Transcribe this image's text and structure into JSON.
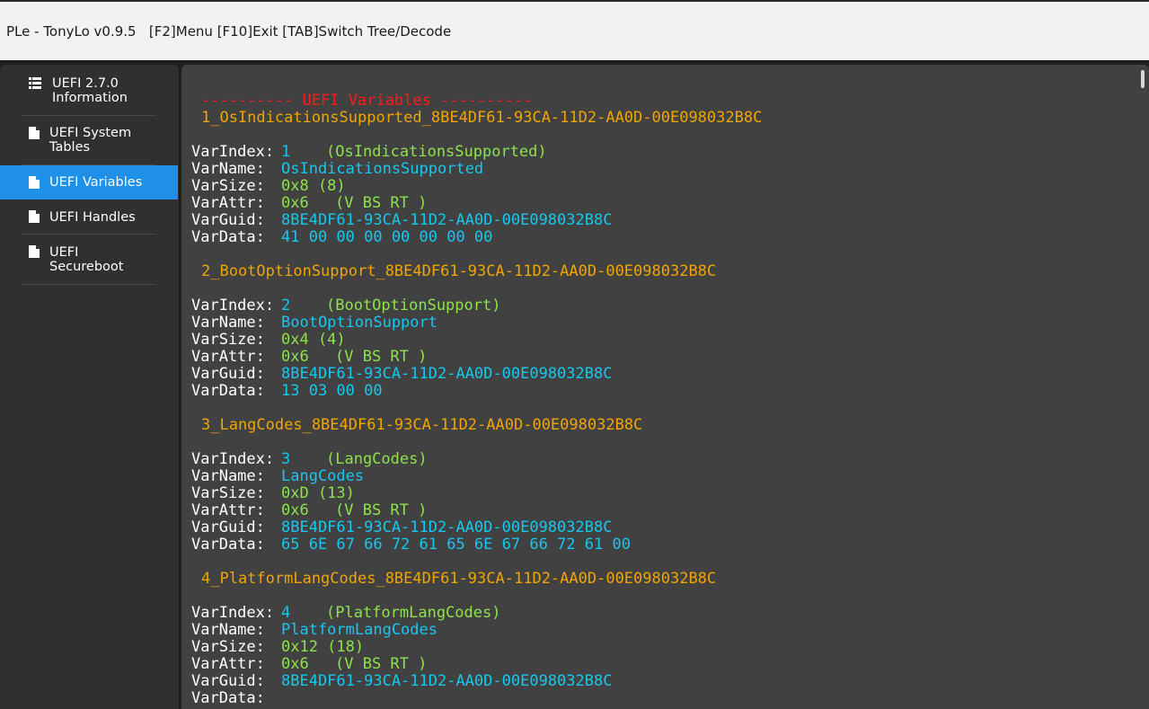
{
  "titlebar": {
    "text": "PLe - TonyLo v0.9.5   [F2]Menu [F10]Exit [TAB]Switch Tree/Decode"
  },
  "sidebar": {
    "items": [
      {
        "label": "UEFI 2.7.0 Information",
        "icon": "list-icon",
        "active": false
      },
      {
        "label": "UEFI System Tables",
        "icon": "file-icon",
        "active": false
      },
      {
        "label": "UEFI Variables",
        "icon": "file-icon",
        "active": true
      },
      {
        "label": "UEFI Handles",
        "icon": "file-icon",
        "active": false
      },
      {
        "label": "UEFI Secureboot",
        "icon": "file-icon",
        "active": false
      }
    ]
  },
  "content": {
    "header": "---------- UEFI Variables ----------",
    "field_labels": {
      "index": "VarIndex:",
      "name": "VarName:",
      "size": "VarSize:",
      "attr": "VarAttr:",
      "guid": "VarGuid:",
      "data": "VarData:"
    },
    "variables": [
      {
        "title": "1_OsIndicationsSupported_8BE4DF61-93CA-11D2-AA0D-00E098032B8C",
        "index": "1",
        "index_name": "(OsIndicationsSupported)",
        "name": "OsIndicationsSupported",
        "size": "0x8 (8)",
        "attr": "0x6",
        "attr_flags": "(V BS RT )",
        "guid": "8BE4DF61-93CA-11D2-AA0D-00E098032B8C",
        "data": "41 00 00 00 00 00 00 00"
      },
      {
        "title": "2_BootOptionSupport_8BE4DF61-93CA-11D2-AA0D-00E098032B8C",
        "index": "2",
        "index_name": "(BootOptionSupport)",
        "name": "BootOptionSupport",
        "size": "0x4 (4)",
        "attr": "0x6",
        "attr_flags": "(V BS RT )",
        "guid": "8BE4DF61-93CA-11D2-AA0D-00E098032B8C",
        "data": "13 03 00 00"
      },
      {
        "title": "3_LangCodes_8BE4DF61-93CA-11D2-AA0D-00E098032B8C",
        "index": "3",
        "index_name": "(LangCodes)",
        "name": "LangCodes",
        "size": "0xD (13)",
        "attr": "0x6",
        "attr_flags": "(V BS RT )",
        "guid": "8BE4DF61-93CA-11D2-AA0D-00E098032B8C",
        "data": "65 6E 67 66 72 61 65 6E 67 66 72 61 00"
      },
      {
        "title": "4_PlatformLangCodes_8BE4DF61-93CA-11D2-AA0D-00E098032B8C",
        "index": "4",
        "index_name": "(PlatformLangCodes)",
        "name": "PlatformLangCodes",
        "size": "0x12 (18)",
        "attr": "0x6",
        "attr_flags": "(V BS RT )",
        "guid": "8BE4DF61-93CA-11D2-AA0D-00E098032B8C",
        "data": ""
      }
    ]
  },
  "colors": {
    "header": "#ff1a1a",
    "title": "#f0a500",
    "label": "#ffffff",
    "value": "#15c8ee",
    "annotation": "#8ee24c",
    "active_nav": "#1e90e8"
  }
}
